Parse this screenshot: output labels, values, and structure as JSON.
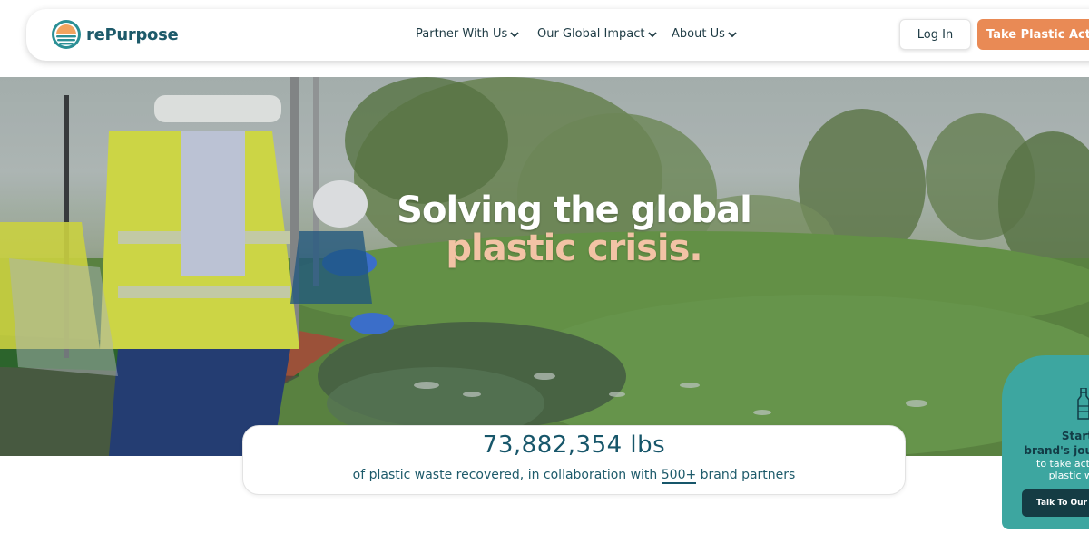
{
  "nav": {
    "brand": "rePurpose",
    "items": [
      {
        "label": "Partner With Us"
      },
      {
        "label": "Our Global Impact"
      },
      {
        "label": "About Us"
      }
    ],
    "login_label": "Log In",
    "cta_label": "Take Plastic Action"
  },
  "hero": {
    "line1": "Solving the global",
    "line2": "plastic crisis."
  },
  "stats": {
    "amount": "73,882,354 lbs",
    "text_before": "of plastic waste recovered, in collaboration with ",
    "highlight": "500+",
    "text_after": " brand partners"
  },
  "side_panel": {
    "line1": "Start",
    "line2": "brand's jou",
    "line3": "to take acti",
    "line4": "plastic w",
    "button_label": "Talk To Our Te"
  },
  "colors": {
    "accent": "#e98a55",
    "brand_teal": "#17566a",
    "panel_teal": "#3da6a0",
    "hero_peach": "#f2c3a5"
  },
  "icons": [
    "repurpose-logo-icon",
    "chevron-down-icon",
    "bottle-icon"
  ]
}
